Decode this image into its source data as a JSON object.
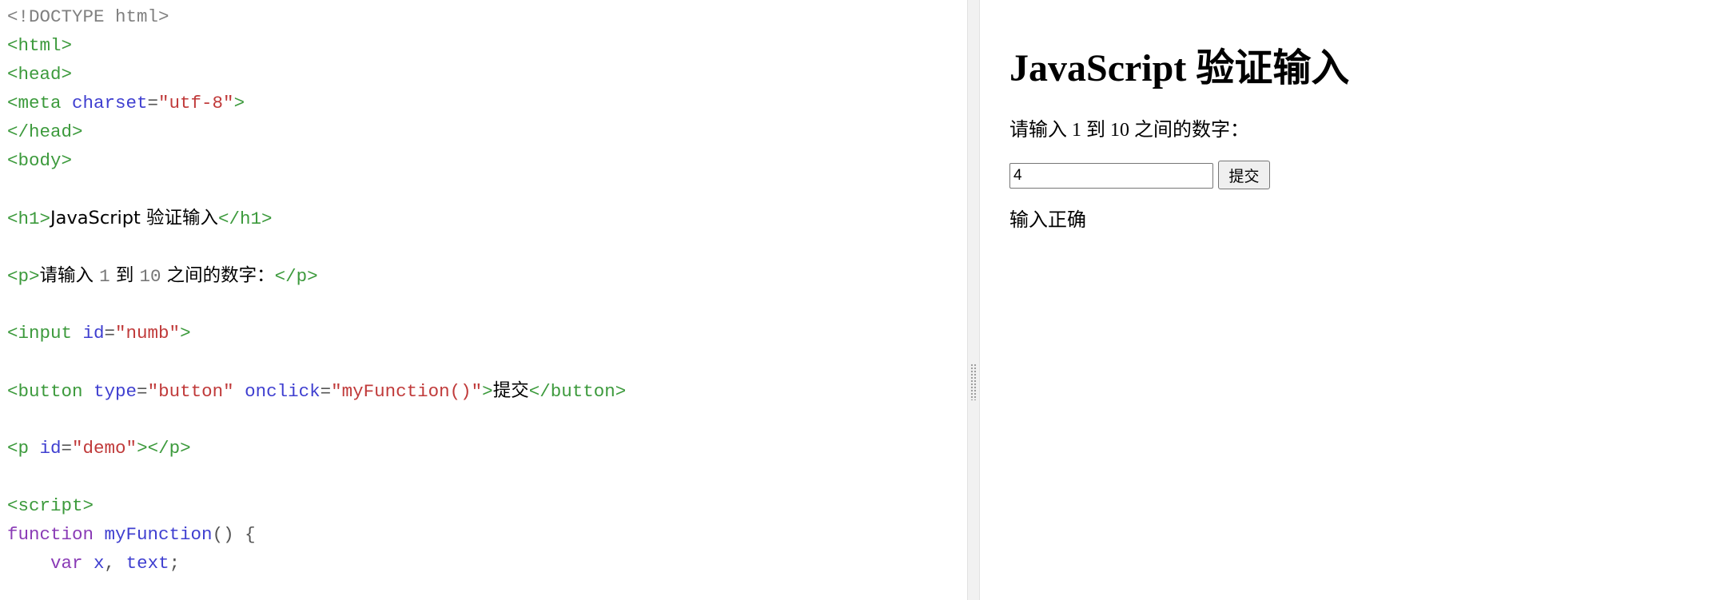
{
  "editor": {
    "lines": [
      [
        {
          "c": "t-doctype",
          "v": "<!DOCTYPE html>"
        }
      ],
      [
        {
          "c": "t-tag",
          "v": "<html>"
        }
      ],
      [
        {
          "c": "t-tag",
          "v": "<head>"
        }
      ],
      [
        {
          "c": "t-tag",
          "v": "<meta "
        },
        {
          "c": "t-attr",
          "v": "charset"
        },
        {
          "c": "t-punct",
          "v": "="
        },
        {
          "c": "t-str",
          "v": "\"utf-8\""
        },
        {
          "c": "t-tag",
          "v": ">"
        }
      ],
      [
        {
          "c": "t-tag",
          "v": "</head>"
        }
      ],
      [
        {
          "c": "t-tag",
          "v": "<body>"
        }
      ],
      [],
      [
        {
          "c": "t-tag",
          "v": "<h1>"
        },
        {
          "c": "t-text",
          "v": "JavaScript 验证输入"
        },
        {
          "c": "t-tag",
          "v": "</h1>"
        }
      ],
      [],
      [
        {
          "c": "t-tag",
          "v": "<p>"
        },
        {
          "c": "t-text",
          "v": "请输入 "
        },
        {
          "c": "t-num",
          "v": "1"
        },
        {
          "c": "t-text",
          "v": " 到 "
        },
        {
          "c": "t-num",
          "v": "10"
        },
        {
          "c": "t-text",
          "v": " 之间的数字："
        },
        {
          "c": "t-tag",
          "v": "</p>"
        }
      ],
      [],
      [
        {
          "c": "t-tag",
          "v": "<input "
        },
        {
          "c": "t-attr",
          "v": "id"
        },
        {
          "c": "t-punct",
          "v": "="
        },
        {
          "c": "t-str",
          "v": "\"numb\""
        },
        {
          "c": "t-tag",
          "v": ">"
        }
      ],
      [],
      [
        {
          "c": "t-tag",
          "v": "<button "
        },
        {
          "c": "t-attr",
          "v": "type"
        },
        {
          "c": "t-punct",
          "v": "="
        },
        {
          "c": "t-str",
          "v": "\"button\""
        },
        {
          "c": "t-attr",
          "v": " onclick"
        },
        {
          "c": "t-punct",
          "v": "="
        },
        {
          "c": "t-str",
          "v": "\"myFunction()\""
        },
        {
          "c": "t-tag",
          "v": ">"
        },
        {
          "c": "t-text",
          "v": "提交"
        },
        {
          "c": "t-tag",
          "v": "</button>"
        }
      ],
      [],
      [
        {
          "c": "t-tag",
          "v": "<p "
        },
        {
          "c": "t-attr",
          "v": "id"
        },
        {
          "c": "t-punct",
          "v": "="
        },
        {
          "c": "t-str",
          "v": "\"demo\""
        },
        {
          "c": "t-tag",
          "v": "></p>"
        }
      ],
      [],
      [
        {
          "c": "t-tag",
          "v": "<script>"
        }
      ],
      [
        {
          "c": "t-kw",
          "v": "function "
        },
        {
          "c": "t-fn",
          "v": "myFunction"
        },
        {
          "c": "t-punct",
          "v": "() {"
        }
      ],
      [
        {
          "c": "t-punct",
          "v": "    "
        },
        {
          "c": "t-kw",
          "v": "var "
        },
        {
          "c": "t-var",
          "v": "x"
        },
        {
          "c": "t-punct",
          "v": ", "
        },
        {
          "c": "t-var",
          "v": "text"
        },
        {
          "c": "t-punct",
          "v": ";"
        }
      ]
    ]
  },
  "preview": {
    "heading": "JavaScript 验证输入",
    "prompt": "请输入 1 到 10 之间的数字：",
    "input_value": "4",
    "submit_label": "提交",
    "result": "输入正确"
  }
}
